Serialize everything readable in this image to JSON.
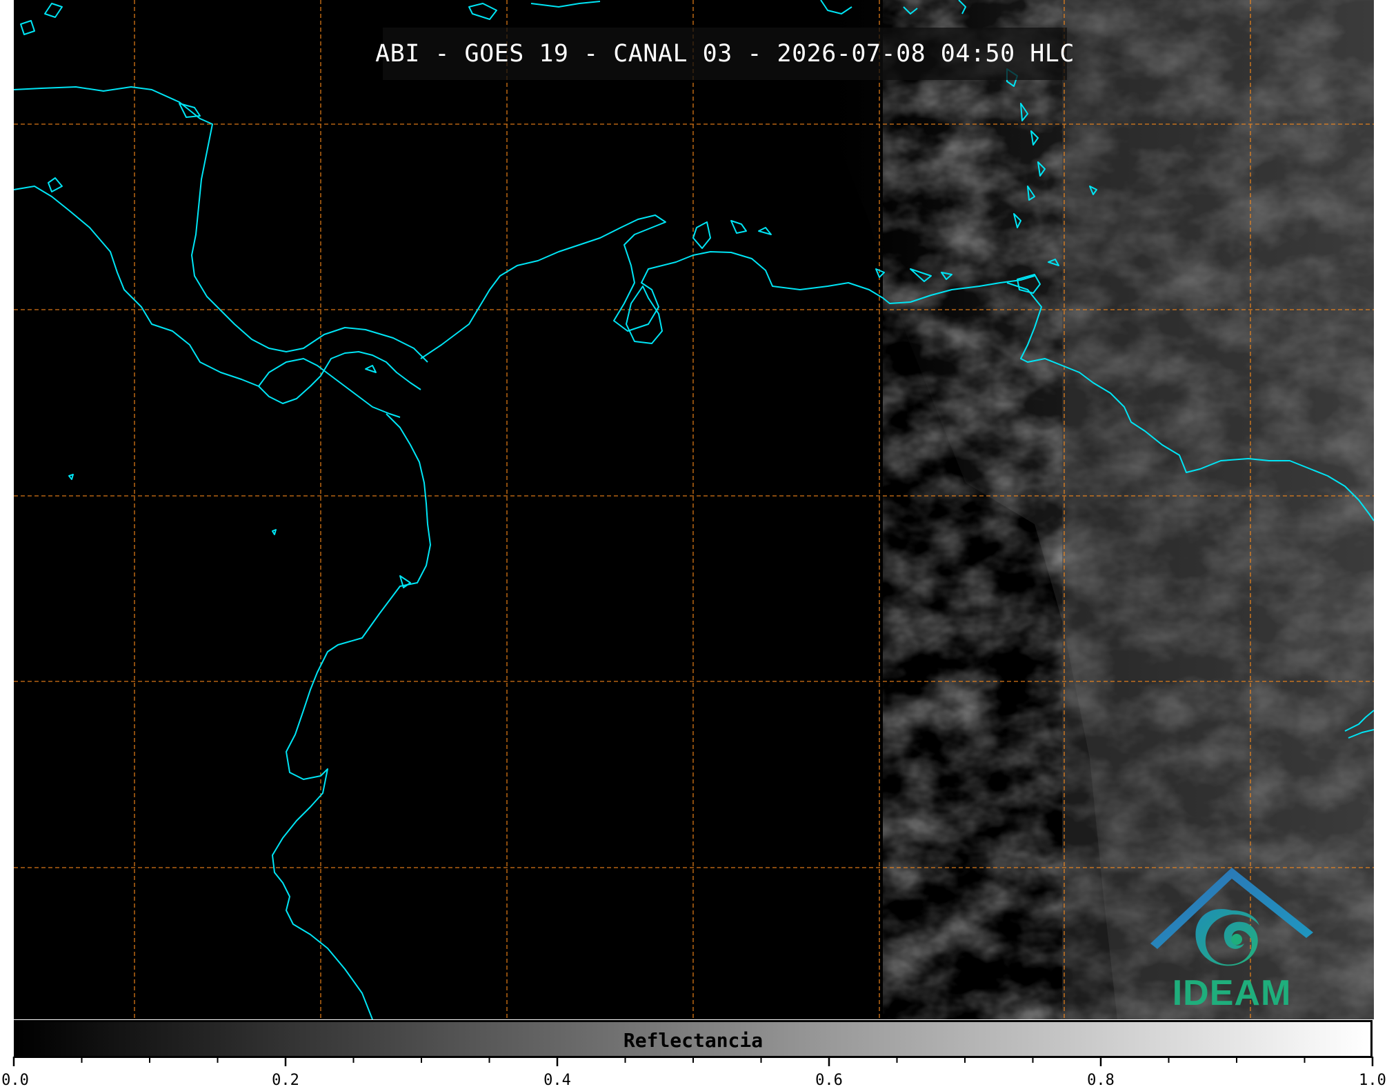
{
  "title": "ABI - GOES 19 - CANAL 03 - 2026-07-08 04:50 HLC",
  "logo": {
    "text": "IDEAM"
  },
  "colorbar": {
    "label": "Reflectancia",
    "range": [
      0.0,
      1.0
    ],
    "tick_labels": [
      "0.0",
      "0.2",
      "0.4",
      "0.6",
      "0.8",
      "1.0"
    ],
    "major_ticks": [
      0.0,
      0.2,
      0.4,
      0.6,
      0.8,
      1.0
    ],
    "minor_step": 0.05,
    "colormap": [
      "#000000",
      "#ffffff"
    ]
  },
  "map": {
    "background_color": "#000000",
    "coastline_color": "#00e5f5",
    "graticule_color": "#ff8c1a",
    "graticule_style": "dashed"
  }
}
